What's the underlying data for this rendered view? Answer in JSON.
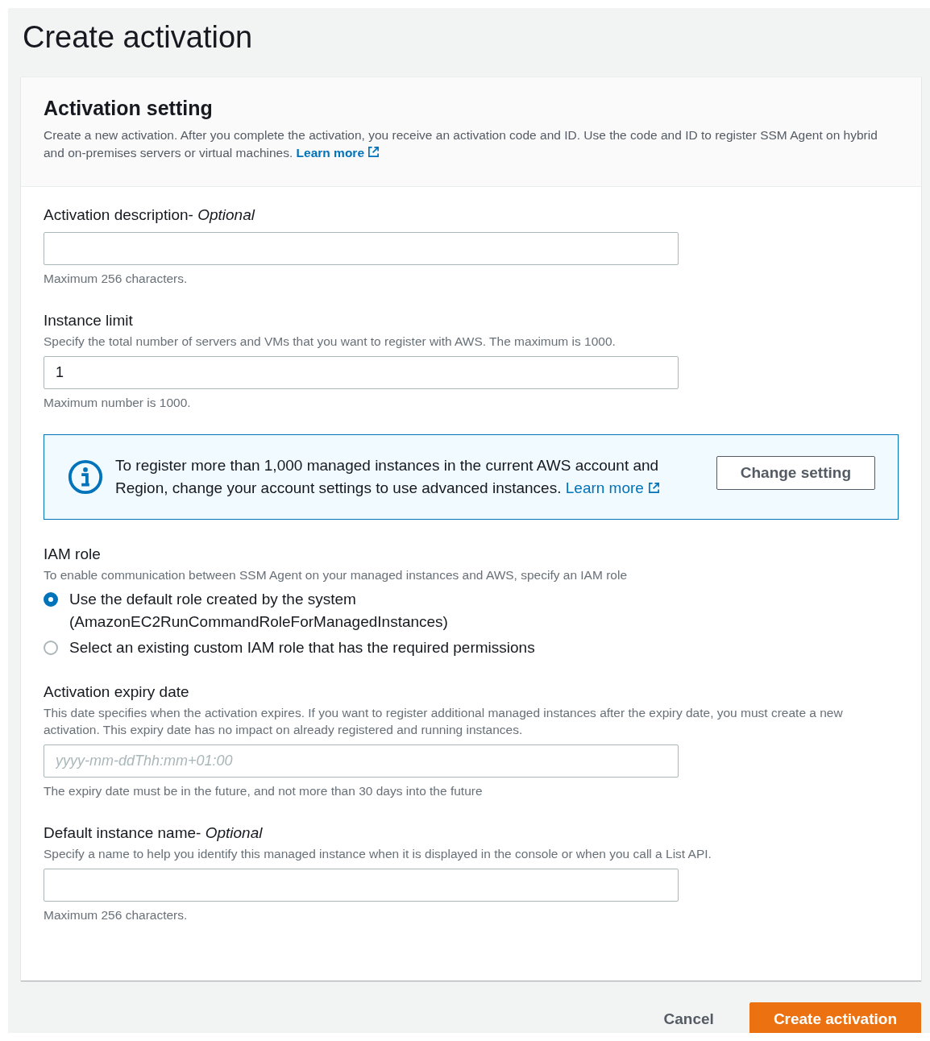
{
  "page_title": "Create activation",
  "container": {
    "title": "Activation setting",
    "description": "Create a new activation. After you complete the activation, you receive an activation code and ID. Use the code and ID to register SSM Agent on hybrid and on-premises servers or virtual machines.",
    "link": "Learn more"
  },
  "sections": [
    {
      "kind": "field",
      "label": "Activation description- *Optional*",
      "hint": "Maximum 256 characters."
    },
    {
      "kind": "field",
      "label": "Instance limit",
      "description": "Specify the total number of servers and VMs that you want to register with AWS. The maximum is 1000.",
      "value": "1",
      "hint": "Maximum number is 1000."
    },
    {
      "kind": "alert",
      "text": "To register more than 1,000 managed instances in the current AWS account and Region, change your account settings to use advanced instances.",
      "link": "Learn more",
      "button": "Change setting"
    },
    {
      "kind": "radio_group",
      "label": "IAM role",
      "description": "To enable communication between SSM Agent on your managed instances and AWS, specify an IAM role",
      "options": [
        {
          "label": "Use the default role created by the system",
          "sublabel": "(AmazonEC2RunCommandRoleForManagedInstances)",
          "selected": true
        },
        {
          "label": "Select an existing custom IAM role that has the required permissions",
          "selected": false
        }
      ]
    },
    {
      "kind": "field",
      "label": "Activation expiry date",
      "description": "This date specifies when the activation expires. If you want to register additional managed instances after the expiry date, you must create a new activation. This expiry date has no impact on already registered and running instances.",
      "placeholder": "yyyy-mm-ddThh:mm+01:00",
      "hint": "The expiry date must be in the future, and not more than 30 days into the future"
    },
    {
      "kind": "field",
      "label": "Default instance name- *Optional*",
      "description": "Specify a name to help you identify this managed instance when it is displayed in the console or when you call a List API.",
      "hint": "Maximum 256 characters."
    }
  ],
  "actions": {
    "cancel": "Cancel",
    "submit": "Create activation"
  }
}
